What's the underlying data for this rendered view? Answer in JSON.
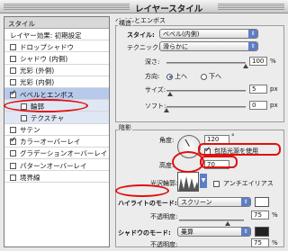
{
  "window": {
    "title": "レイヤースタイル"
  },
  "left_panel": {
    "header": "スタイル",
    "items": [
      {
        "label": "レイヤー効果: 初期設定",
        "checked": null,
        "selected": false,
        "sub": false
      },
      {
        "label": "ドロップシャドウ",
        "checked": false,
        "selected": false,
        "sub": false
      },
      {
        "label": "シャドウ (内側)",
        "checked": false,
        "selected": false,
        "sub": false
      },
      {
        "label": "光彩 (外側)",
        "checked": false,
        "selected": false,
        "sub": false
      },
      {
        "label": "光彩 (内側)",
        "checked": false,
        "selected": false,
        "sub": false
      },
      {
        "label": "ベベルとエンボス",
        "checked": true,
        "selected": true,
        "sub": false
      },
      {
        "label": "輪郭",
        "checked": false,
        "selected": false,
        "sub": true
      },
      {
        "label": "テクスチャ",
        "checked": false,
        "selected": false,
        "sub": true
      },
      {
        "label": "サテン",
        "checked": false,
        "selected": false,
        "sub": false
      },
      {
        "label": "カラーオーバーレイ",
        "checked": true,
        "selected": false,
        "sub": false
      },
      {
        "label": "グラデーションオーバーレイ",
        "checked": false,
        "selected": false,
        "sub": false
      },
      {
        "label": "パターンオーバーレイ",
        "checked": false,
        "selected": false,
        "sub": false
      },
      {
        "label": "境界線",
        "checked": false,
        "selected": false,
        "sub": false
      }
    ]
  },
  "bevel": {
    "group_title": "ベベルとエンボス",
    "structure_title": "構造",
    "style_label": "スタイル:",
    "style_value": "ベベル(内側)",
    "technique_label": "テクニック:",
    "technique_value": "滑らかに",
    "depth_label": "深さ:",
    "depth_value": "100",
    "depth_level": 1.0,
    "depth_unit": "%",
    "direction_label": "方向:",
    "direction_up": "上へ",
    "direction_down": "下へ",
    "size_label": "サイズ:",
    "size_value": "5",
    "size_level": 0.05,
    "size_unit": "px",
    "soften_label": "ソフト:",
    "soften_value": "0",
    "soften_level": 0.0,
    "soften_unit": "px"
  },
  "shading": {
    "title": "陰影",
    "angle_label": "角度:",
    "angle_value": "120",
    "angle_unit": "°",
    "use_global_light": "包括光源を使用",
    "altitude_label": "高度:",
    "altitude_value": "70",
    "gloss_contour_label": "光沢輪郭:",
    "anti_alias": "アンチエイリアス",
    "highlight_mode_label": "ハイライトのモード:",
    "highlight_mode_value": "スクリーン",
    "highlight_opacity_label": "不透明度:",
    "highlight_opacity_value": "75",
    "highlight_opacity_level": 0.75,
    "shadow_mode_label": "シャドウのモード:",
    "shadow_mode_value": "乗算",
    "shadow_opacity_label": "不透明度:",
    "shadow_opacity_value": "75",
    "shadow_opacity_level": 0.75,
    "opacity_unit": "%"
  },
  "colors": {
    "accent": "#5d7ec6",
    "annotation": "#e01010"
  }
}
